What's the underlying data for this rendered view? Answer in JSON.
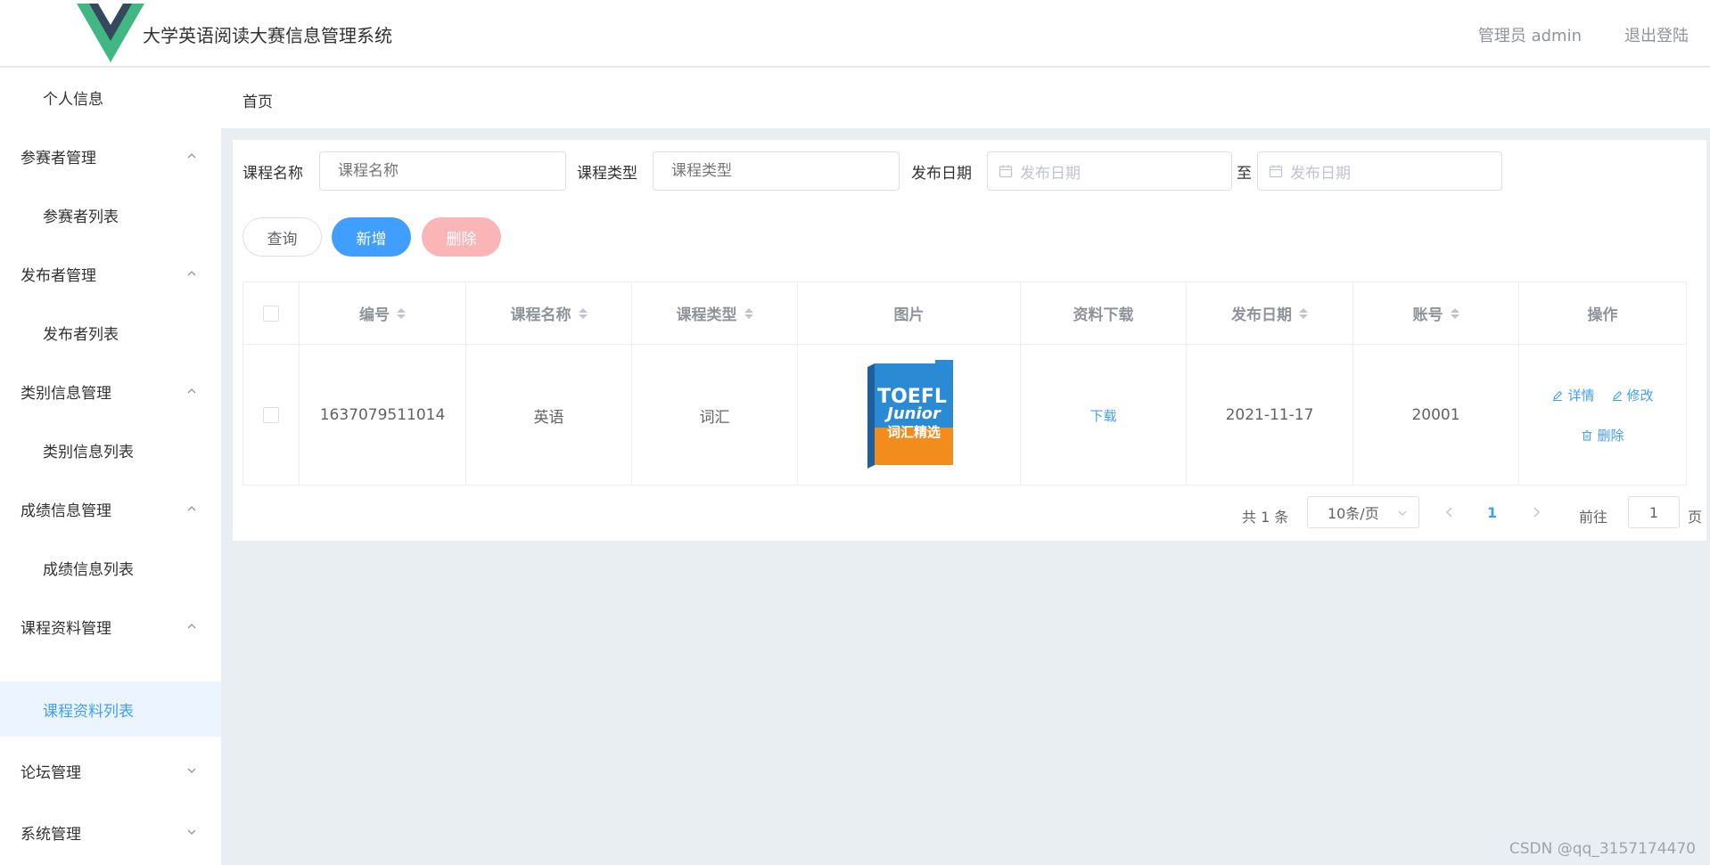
{
  "header": {
    "title": "大学英语阅读大赛信息管理系统",
    "admin": "管理员 admin",
    "logout": "退出登陆"
  },
  "sidebar": {
    "items": [
      {
        "label": "个人信息",
        "level": "sub"
      },
      {
        "label": "参赛者管理",
        "level": "group",
        "expanded": true
      },
      {
        "label": "参赛者列表",
        "level": "sub"
      },
      {
        "label": "发布者管理",
        "level": "group",
        "expanded": true
      },
      {
        "label": "发布者列表",
        "level": "sub"
      },
      {
        "label": "类别信息管理",
        "level": "group",
        "expanded": true
      },
      {
        "label": "类别信息列表",
        "level": "sub"
      },
      {
        "label": "成绩信息管理",
        "level": "group",
        "expanded": true
      },
      {
        "label": "成绩信息列表",
        "level": "sub"
      },
      {
        "label": "课程资料管理",
        "level": "group",
        "expanded": true
      },
      {
        "label": "课程资料列表",
        "level": "sub",
        "active": true
      },
      {
        "label": "论坛管理",
        "level": "group",
        "expanded": false
      },
      {
        "label": "系统管理",
        "level": "group",
        "expanded": false
      }
    ]
  },
  "breadcrumb": "首页",
  "search": {
    "course_name_label": "课程名称",
    "course_name_placeholder": "课程名称",
    "course_type_label": "课程类型",
    "course_type_placeholder": "课程类型",
    "date_label": "发布日期",
    "date_start_placeholder": "发布日期",
    "date_to": "至",
    "date_end_placeholder": "发布日期"
  },
  "buttons": {
    "query": "查询",
    "add": "新增",
    "delete": "删除"
  },
  "table": {
    "headers": [
      "编号",
      "课程名称",
      "课程类型",
      "图片",
      "资料下载",
      "发布日期",
      "账号",
      "操作"
    ],
    "rows": [
      {
        "id": "1637079511014",
        "course_name": "英语",
        "course_type": "词汇",
        "image_text_1": "TOEFL",
        "image_text_2": "Junior",
        "image_text_3": "词汇精选",
        "download": "下载",
        "date": "2021-11-17",
        "account": "20001",
        "op_detail": "详情",
        "op_edit": "修改",
        "op_delete": "删除"
      }
    ]
  },
  "pagination": {
    "total": "共 1 条",
    "page_size": "10条/页",
    "current": "1",
    "goto_label": "前往",
    "goto_value": "1",
    "page_suffix": "页"
  },
  "watermark": "CSDN @qq_3157174470",
  "colors": {
    "primary": "#409eff",
    "danger_light": "#fab6b6",
    "logo_green": "#41b883",
    "logo_dark": "#35495e"
  }
}
